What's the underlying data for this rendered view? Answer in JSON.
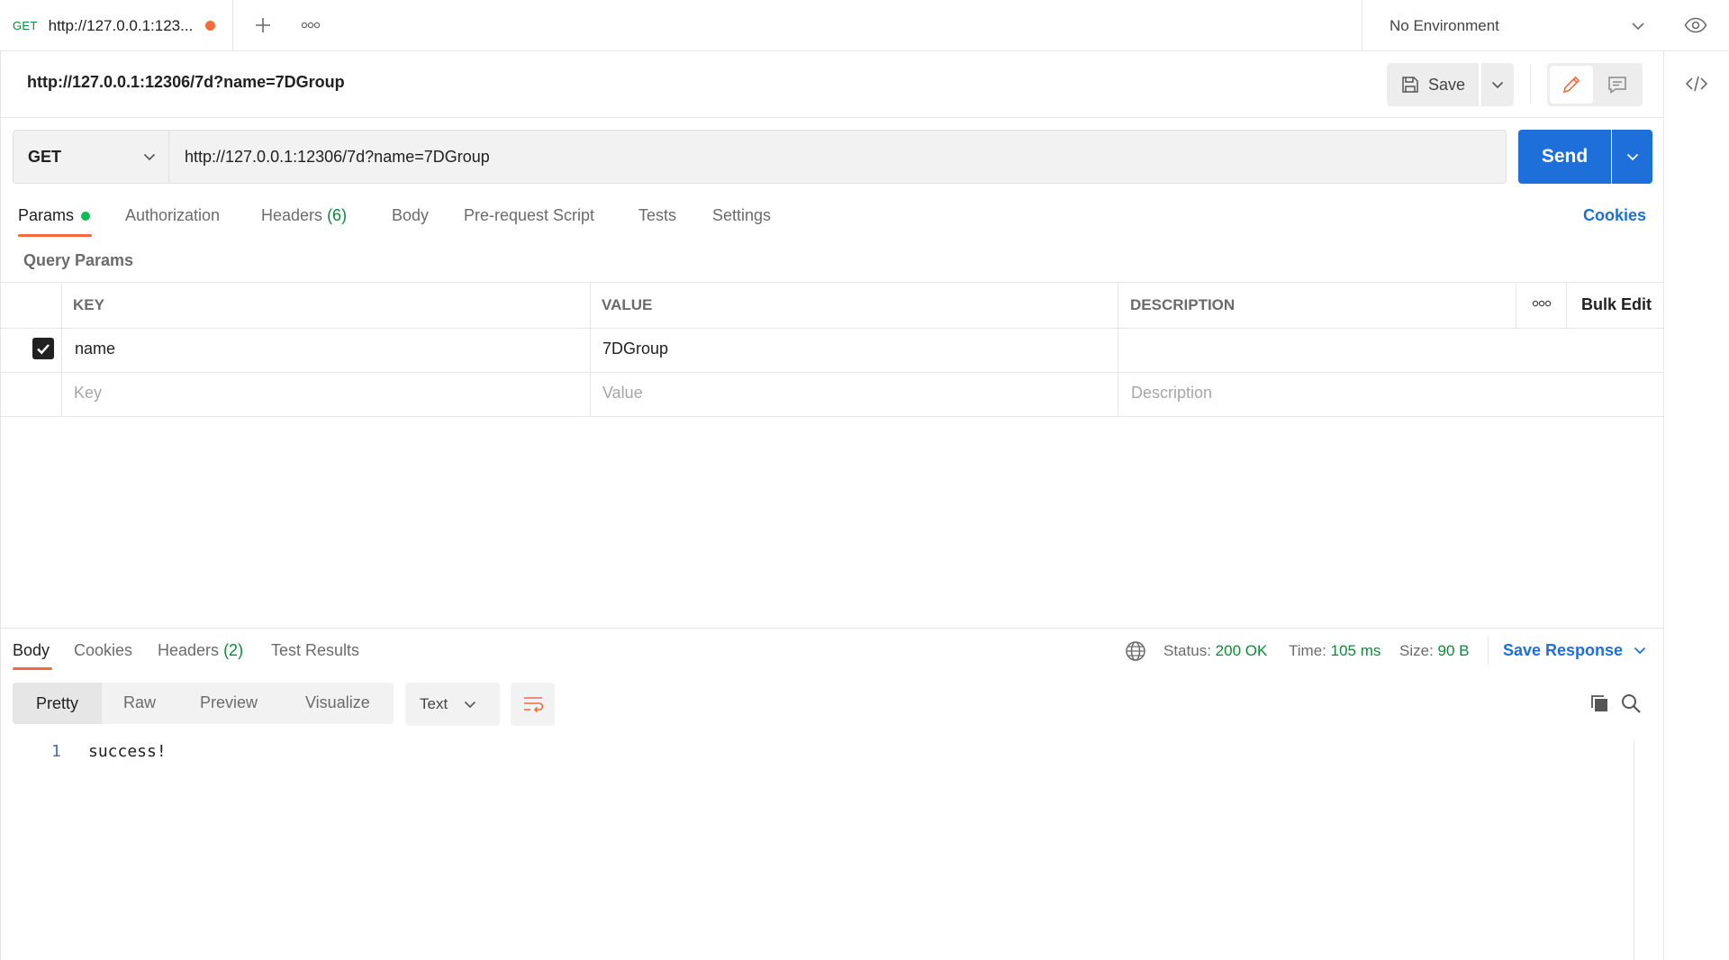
{
  "tab": {
    "method": "GET",
    "title": "http://127.0.0.1:123..."
  },
  "environment": {
    "label": "No Environment"
  },
  "request": {
    "name": "http://127.0.0.1:12306/7d?name=7DGroup",
    "save_label": "Save",
    "method": "GET",
    "url": "http://127.0.0.1:12306/7d?name=7DGroup",
    "send_label": "Send"
  },
  "request_tabs": {
    "params": "Params",
    "authorization": "Authorization",
    "headers": "Headers",
    "headers_count": "(6)",
    "body": "Body",
    "prerequest": "Pre-request Script",
    "tests": "Tests",
    "settings": "Settings",
    "cookies": "Cookies"
  },
  "query_params": {
    "title": "Query Params",
    "columns": {
      "key": "KEY",
      "value": "VALUE",
      "description": "DESCRIPTION"
    },
    "bulk_edit": "Bulk Edit",
    "rows": [
      {
        "checked": true,
        "key": "name",
        "value": "7DGroup",
        "description": ""
      }
    ],
    "placeholders": {
      "key": "Key",
      "value": "Value",
      "description": "Description"
    }
  },
  "response": {
    "tabs": {
      "body": "Body",
      "cookies": "Cookies",
      "headers": "Headers",
      "headers_count": "(2)",
      "test_results": "Test Results"
    },
    "status_label": "Status:",
    "status_value": "200 OK",
    "time_label": "Time:",
    "time_value": "105 ms",
    "size_label": "Size:",
    "size_value": "90 B",
    "save_response": "Save Response",
    "views": {
      "pretty": "Pretty",
      "raw": "Raw",
      "preview": "Preview",
      "visualize": "Visualize"
    },
    "format": "Text",
    "line_number": "1",
    "content": "success!"
  },
  "colors": {
    "accent": "#f26b3a",
    "primary": "#1f6fdb",
    "success": "#0d8a39"
  }
}
